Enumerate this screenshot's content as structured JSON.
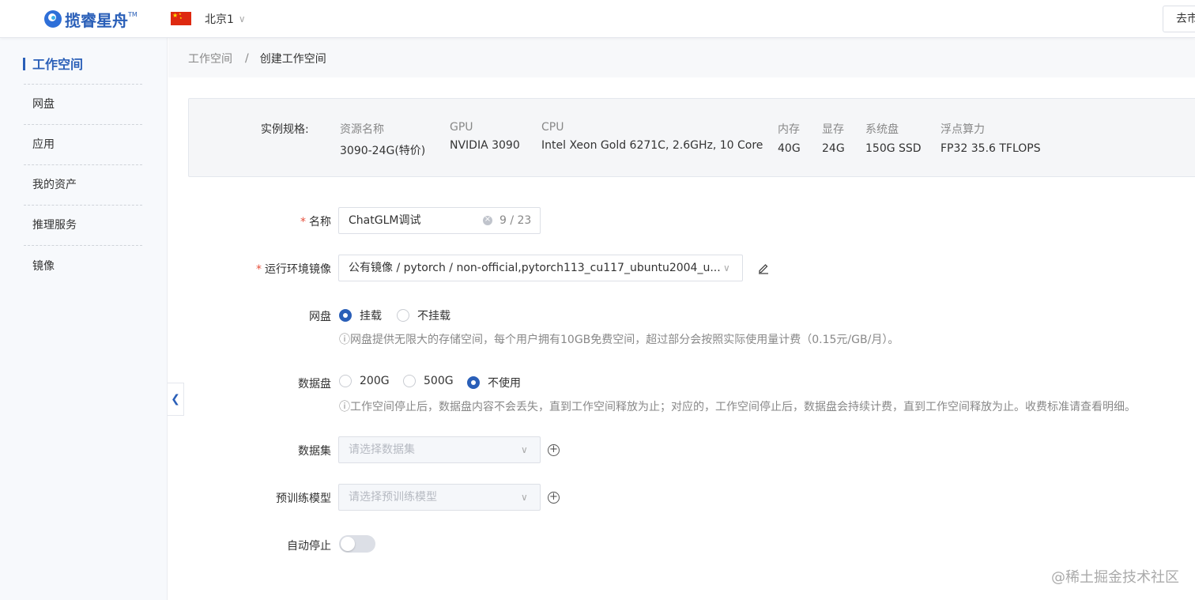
{
  "header": {
    "logo_text": "揽睿星舟",
    "logo_tm": "TM",
    "region": "北京1",
    "right_button": "去市"
  },
  "sidebar": {
    "items": [
      {
        "label": "工作空间",
        "active": true
      },
      {
        "label": "网盘"
      },
      {
        "label": "应用"
      },
      {
        "label": "我的资产"
      },
      {
        "label": "推理服务"
      },
      {
        "label": "镜像"
      }
    ]
  },
  "breadcrumb": {
    "parent": "工作空间",
    "separator": "/",
    "current": "创建工作空间"
  },
  "spec": {
    "label": "实例规格:",
    "columns": [
      {
        "header": "资源名称",
        "value": "3090-24G(特价)"
      },
      {
        "header": "GPU",
        "value": "NVIDIA 3090"
      },
      {
        "header": "CPU",
        "value": "Intel Xeon Gold 6271C, 2.6GHz, 10 Core"
      },
      {
        "header": "内存",
        "value": "40G"
      },
      {
        "header": "显存",
        "value": "24G"
      },
      {
        "header": "系统盘",
        "value": "150G SSD"
      },
      {
        "header": "浮点算力",
        "value": "FP32 35.6 TFLOPS"
      }
    ]
  },
  "form": {
    "name": {
      "label": "名称",
      "required_mark": "*",
      "value": "ChatGLM调试",
      "counter": "9 / 23"
    },
    "image": {
      "label": "运行环境镜像",
      "required_mark": "*",
      "value": "公有镜像 / pytorch / non-official,pytorch113_cu117_ubuntu2004_u..."
    },
    "netdisk": {
      "label": "网盘",
      "options": [
        {
          "label": "挂载",
          "checked": true
        },
        {
          "label": "不挂载",
          "checked": false
        }
      ],
      "tip": "ⓘ网盘提供无限大的存储空间，每个用户拥有10GB免费空间，超过部分会按照实际使用量计费（0.15元/GB/月）。"
    },
    "datadisk": {
      "label": "数据盘",
      "options": [
        {
          "label": "200G",
          "checked": false
        },
        {
          "label": "500G",
          "checked": false
        },
        {
          "label": "不使用",
          "checked": true
        }
      ],
      "tip": "ⓘ工作空间停止后，数据盘内容不会丢失，直到工作空间释放为止；对应的，工作空间停止后，数据盘会持续计费，直到工作空间释放为止。收费标准请查看明细。"
    },
    "dataset": {
      "label": "数据集",
      "placeholder": "请选择数据集"
    },
    "pretrained": {
      "label": "预训练模型",
      "placeholder": "请选择预训练模型"
    },
    "autostop": {
      "label": "自动停止",
      "enabled": false
    }
  },
  "watermark": "@稀土掘金技术社区",
  "colors": {
    "accent": "#2a5fb8",
    "required": "#e6503c"
  }
}
